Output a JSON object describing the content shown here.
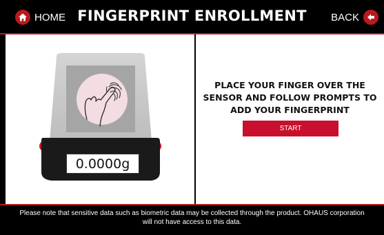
{
  "header": {
    "home_label": "HOME",
    "title": "FINGERPRINT ENROLLMENT",
    "back_label": "BACK"
  },
  "scale": {
    "weight_display": "0.0000g"
  },
  "enrollment": {
    "prompt_line1": "PLACE YOUR FINGER OVER THE",
    "prompt_line2": "SENSOR AND FOLLOW PROMPTS TO",
    "prompt_line3": "ADD YOUR FINGERPRINT",
    "start_label": "START"
  },
  "footer": {
    "notice_line1": "Please note that sensitive data such as biometric data may be collected through the product. OHAUS corporation",
    "notice_line2": "will not have access to this data."
  },
  "icons": {
    "home": "home-icon",
    "back": "back-arrow-icon",
    "fingerprint": "fingerprint-icon"
  },
  "colors": {
    "accent": "#b81a1e",
    "start_button": "#c8102e",
    "background": "#000000",
    "panel": "#ffffff",
    "sensor_circle": "#f3dde2"
  }
}
